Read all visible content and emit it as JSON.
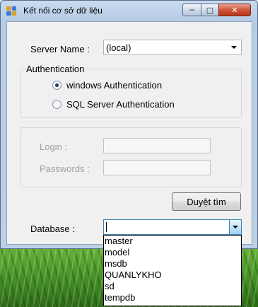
{
  "window": {
    "title": "Kết nối cơ sở dữ liệu",
    "controls": {
      "minimize": "─",
      "maximize": "□",
      "close": "✕"
    },
    "icon_colors": [
      "#e0a020",
      "#3a7bd5",
      "#3a7bd5",
      "#e0a020"
    ]
  },
  "server": {
    "label": "Server Name :",
    "value": "(local)"
  },
  "authentication": {
    "title": "Authentication",
    "options": [
      {
        "label": "windows Authentication",
        "checked": true
      },
      {
        "label": "SQL Server Authentication",
        "checked": false
      }
    ]
  },
  "credentials": {
    "login_label": "Login :",
    "password_label": "Passwords :",
    "login_value": "",
    "password_value": ""
  },
  "browse_button": "Duyệt tìm",
  "database": {
    "label": "Database :",
    "value": "",
    "options": [
      "master",
      "model",
      "msdb",
      "QUANLYKHO",
      "sd",
      "tempdb"
    ]
  }
}
